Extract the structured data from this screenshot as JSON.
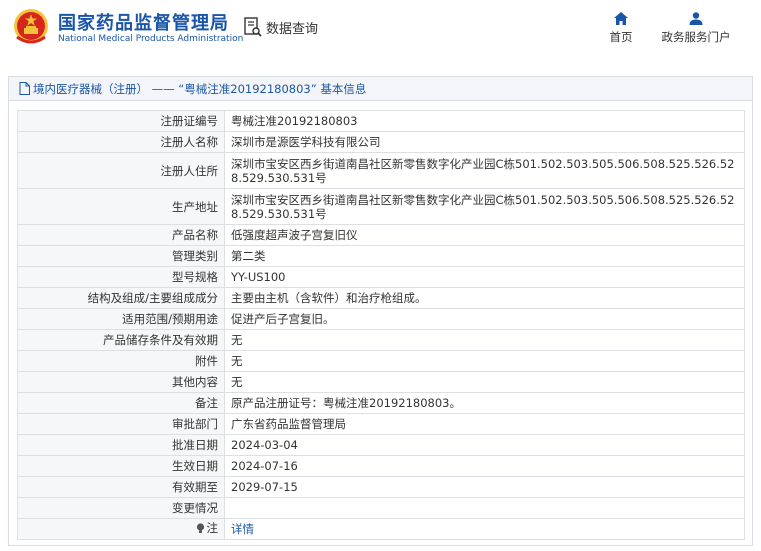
{
  "header": {
    "org_cn": "国家药品监督管理局",
    "org_en": "National Medical Products Administration",
    "query_label": "数据查询",
    "nav": [
      {
        "label": "首页",
        "icon": "home-icon"
      },
      {
        "label": "政务服务门户",
        "icon": "user-icon"
      }
    ]
  },
  "panel": {
    "title": "境内医疗器械（注册） —— “粤械注准20192180803” 基本信息"
  },
  "rows": [
    {
      "key": "注册证编号",
      "value": "粤械注准20192180803"
    },
    {
      "key": "注册人名称",
      "value": "深圳市是源医学科技有限公司"
    },
    {
      "key": "注册人住所",
      "value": "深圳市宝安区西乡街道南昌社区新零售数字化产业园C栋501.502.503.505.506.508.525.526.528.529.530.531号"
    },
    {
      "key": "生产地址",
      "value": "深圳市宝安区西乡街道南昌社区新零售数字化产业园C栋501.502.503.505.506.508.525.526.528.529.530.531号"
    },
    {
      "key": "产品名称",
      "value": "低强度超声波子宫复旧仪"
    },
    {
      "key": "管理类别",
      "value": "第二类"
    },
    {
      "key": "型号规格",
      "value": "YY-US100"
    },
    {
      "key": "结构及组成/主要组成成分",
      "value": "主要由主机（含软件）和治疗枪组成。"
    },
    {
      "key": "适用范围/预期用途",
      "value": "促进产后子宫复旧。"
    },
    {
      "key": "产品储存条件及有效期",
      "value": "无"
    },
    {
      "key": "附件",
      "value": "无"
    },
    {
      "key": "其他内容",
      "value": "无"
    },
    {
      "key": "备注",
      "value": "原产品注册证号：粤械注准20192180803。"
    },
    {
      "key": "审批部门",
      "value": "广东省药品监督管理局"
    },
    {
      "key": "批准日期",
      "value": "2024-03-04"
    },
    {
      "key": "生效日期",
      "value": "2024-07-16"
    },
    {
      "key": "有效期至",
      "value": "2029-07-15"
    },
    {
      "key": "变更情况",
      "value": ""
    },
    {
      "key": "注",
      "value": "详情"
    }
  ],
  "colors": {
    "brand_blue": "#1a56a8",
    "emblem_red": "#d7261e",
    "emblem_gold": "#f3c43a"
  }
}
